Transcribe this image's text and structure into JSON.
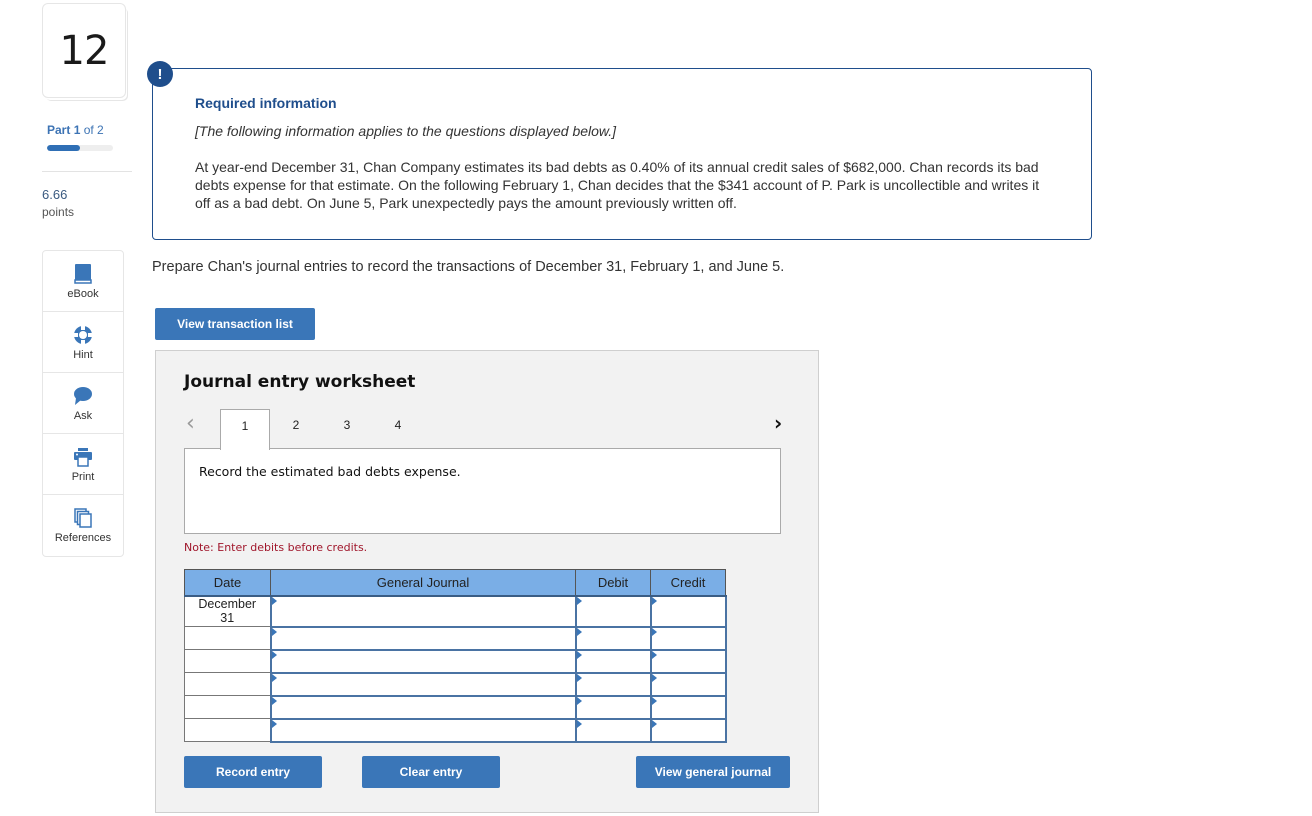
{
  "question": {
    "number": "12",
    "part_current": "1",
    "part_of_text": "of 2",
    "part_word": "Part",
    "progress_fraction": 0.5,
    "points_value": "6.66",
    "points_label": "points"
  },
  "tools": [
    {
      "label": "eBook",
      "icon": "book-icon"
    },
    {
      "label": "Hint",
      "icon": "lifebuoy-icon"
    },
    {
      "label": "Ask",
      "icon": "speech-bubble-icon"
    },
    {
      "label": "Print",
      "icon": "printer-icon"
    },
    {
      "label": "References",
      "icon": "documents-icon"
    }
  ],
  "info": {
    "badge": "!",
    "title": "Required information",
    "subtitle": "[The following information applies to the questions displayed below.]",
    "body": "At year-end December 31, Chan Company estimates its bad debts as 0.40% of its annual credit sales of $682,000. Chan records its bad debts expense for that estimate. On the following February 1, Chan decides that the $341 account of P. Park is uncollectible and writes it off as a bad debt. On June 5, Park unexpectedly pays the amount previously written off."
  },
  "prompt": "Prepare Chan's journal entries to record the transactions of December 31, February 1, and June 5.",
  "buttons": {
    "view_transaction_list": "View transaction list",
    "record_entry": "Record entry",
    "clear_entry": "Clear entry",
    "view_general_journal": "View general journal"
  },
  "worksheet": {
    "title": "Journal entry worksheet",
    "nav_prev": "<",
    "nav_next": ">",
    "tabs": [
      "1",
      "2",
      "3",
      "4"
    ],
    "active_tab": "1",
    "description": "Record the estimated bad debts expense.",
    "note": "Note: Enter debits before credits.",
    "columns": [
      "Date",
      "General Journal",
      "Debit",
      "Credit"
    ],
    "rows": [
      {
        "date": "December 31",
        "account": "",
        "debit": "",
        "credit": ""
      },
      {
        "date": "",
        "account": "",
        "debit": "",
        "credit": ""
      },
      {
        "date": "",
        "account": "",
        "debit": "",
        "credit": ""
      },
      {
        "date": "",
        "account": "",
        "debit": "",
        "credit": ""
      },
      {
        "date": "",
        "account": "",
        "debit": "",
        "credit": ""
      },
      {
        "date": "",
        "account": "",
        "debit": "",
        "credit": ""
      }
    ]
  },
  "colors": {
    "accent": "#3a76b8",
    "info_border": "#1f4e8c",
    "table_header": "#7aaee6",
    "note": "#a0162b"
  }
}
